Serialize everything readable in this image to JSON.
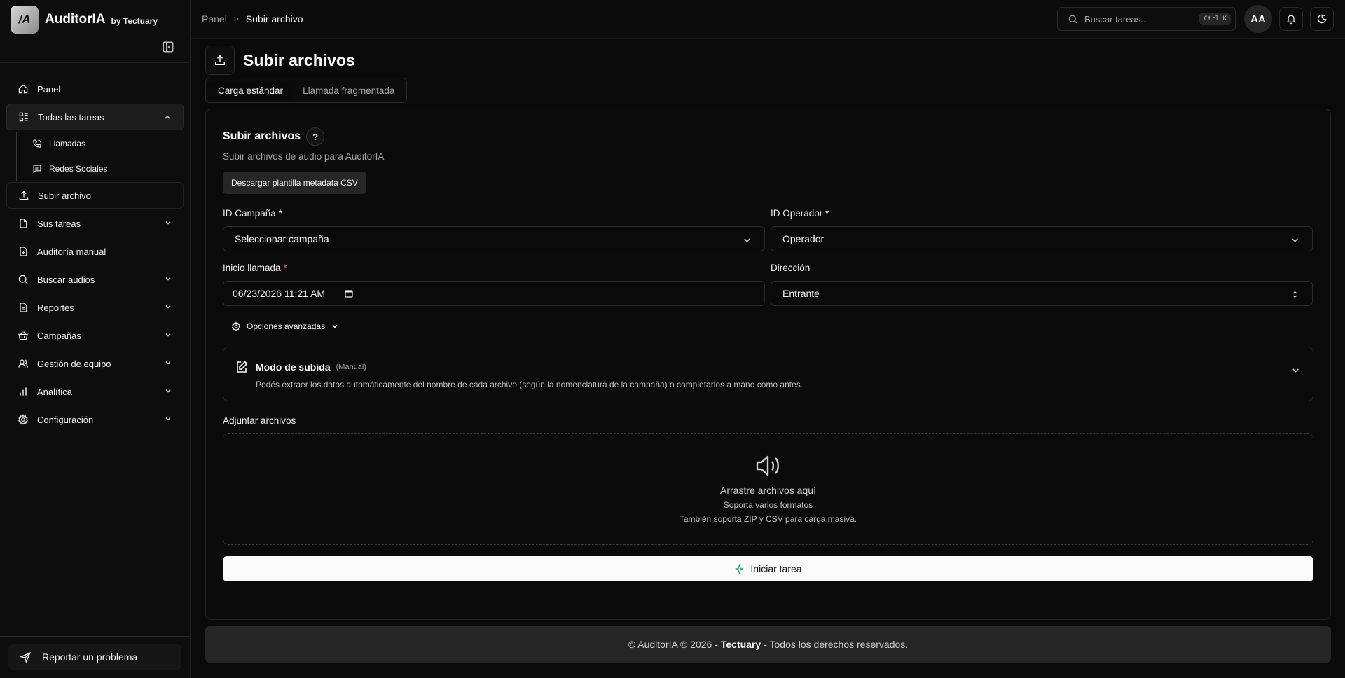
{
  "brand": {
    "logo_text": "/A",
    "name": "AuditorIA",
    "by": "by Tectuary"
  },
  "sidebar": {
    "items": [
      {
        "label": "Panel"
      },
      {
        "label": "Todas las tareas",
        "sub": [
          {
            "label": "Llamadas"
          },
          {
            "label": "Redes Sociales"
          }
        ]
      },
      {
        "label": "Subir archivo"
      },
      {
        "label": "Sus tareas"
      },
      {
        "label": "Auditoría manual"
      },
      {
        "label": "Buscar audios"
      },
      {
        "label": "Reportes"
      },
      {
        "label": "Campañas"
      },
      {
        "label": "Gestión de equipo"
      },
      {
        "label": "Analítica"
      },
      {
        "label": "Configuración"
      }
    ],
    "report_label": "Reportar un problema"
  },
  "topbar": {
    "crumb_root": "Panel",
    "crumb_sep": ">",
    "crumb_current": "Subir archivo",
    "search_placeholder": "Buscar tareas...",
    "search_kbd": "Ctrl K",
    "avatar": "AA"
  },
  "page": {
    "title": "Subir archivos",
    "tabs": [
      {
        "label": "Carga estándar"
      },
      {
        "label": "Llamada fragmentada"
      }
    ]
  },
  "form": {
    "heading": "Subir archivos",
    "help": "?",
    "subtitle": "Subir archivos de audio para AuditorIA",
    "download_btn": "Descargar plantilla metadata CSV",
    "campaign_label": "ID Campaña *",
    "campaign_value": "Seleccionar campaña",
    "operator_label": "ID Operador *",
    "operator_value": "Operador",
    "start_label": "Inicio llamada",
    "start_req": "*",
    "start_value": "06/23/2026 11:21 AM",
    "direction_label": "Dirección",
    "direction_value": "Entrante",
    "advanced": "Opciones avanzadas",
    "mode_title": "Modo de subida",
    "mode_tag": "(Manual)",
    "mode_desc": "Podés extraer los datos automáticamente del nombre de cada archivo (según la nomenclatura de la campaña) o completarlos a mano como antes.",
    "attach_label": "Adjuntar archivos",
    "drop_main": "Arrastre archivos aquí",
    "drop_s1": "Soporta varios formatos",
    "drop_s2": "También soporta ZIP y CSV para carga masiva.",
    "start_btn": "Iniciar tarea"
  },
  "footer": {
    "pre": "©  AuditorIA © 2026 -",
    "company": "Tectuary",
    "post": "- Todos los derechos reservados."
  }
}
